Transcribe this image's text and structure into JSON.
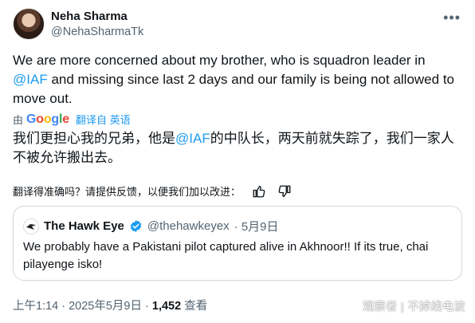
{
  "author": {
    "name": "Neha Sharma",
    "handle": "@NehaSharmaTk",
    "more_icon": "ellipsis-icon"
  },
  "tweet": {
    "text_before": "We are more concerned about my brother, who is squadron leader in ",
    "mention": "@IAF",
    "text_after": " and missing since last 2 days and our family is being not allowed to move out."
  },
  "translation": {
    "by_label": "由",
    "provider": "Google",
    "link_label": "翻译自 英语",
    "text_before": "我们更担心我的兄弟，他是",
    "mention": "@IAF",
    "text_after": "的中队长，两天前就失踪了，我们一家人不被允许搬出去。"
  },
  "feedback": {
    "question": "翻译得准确吗？请提供反馈，以便我们加以改进：",
    "thumbs_up_icon": "thumbs-up-icon",
    "thumbs_down_icon": "thumbs-down-icon"
  },
  "quote": {
    "name": "The Hawk Eye",
    "handle": "@thehawkeyex",
    "date": "· 5月9日",
    "text": "We probably have a Pakistani pilot captured alive in Akhnoor!! If its true, chai pilayenge isko!",
    "verified_color": "#1d9bf0"
  },
  "meta": {
    "time": "上午1:14 · 2025年5月9日 · ",
    "views": "1,452",
    "views_label": " 查看"
  },
  "watermark": "观察者 | 不掉线电波",
  "colors": {
    "accent": "#1d9bf0",
    "secondary_text": "#536471",
    "border": "#cfd9de"
  }
}
